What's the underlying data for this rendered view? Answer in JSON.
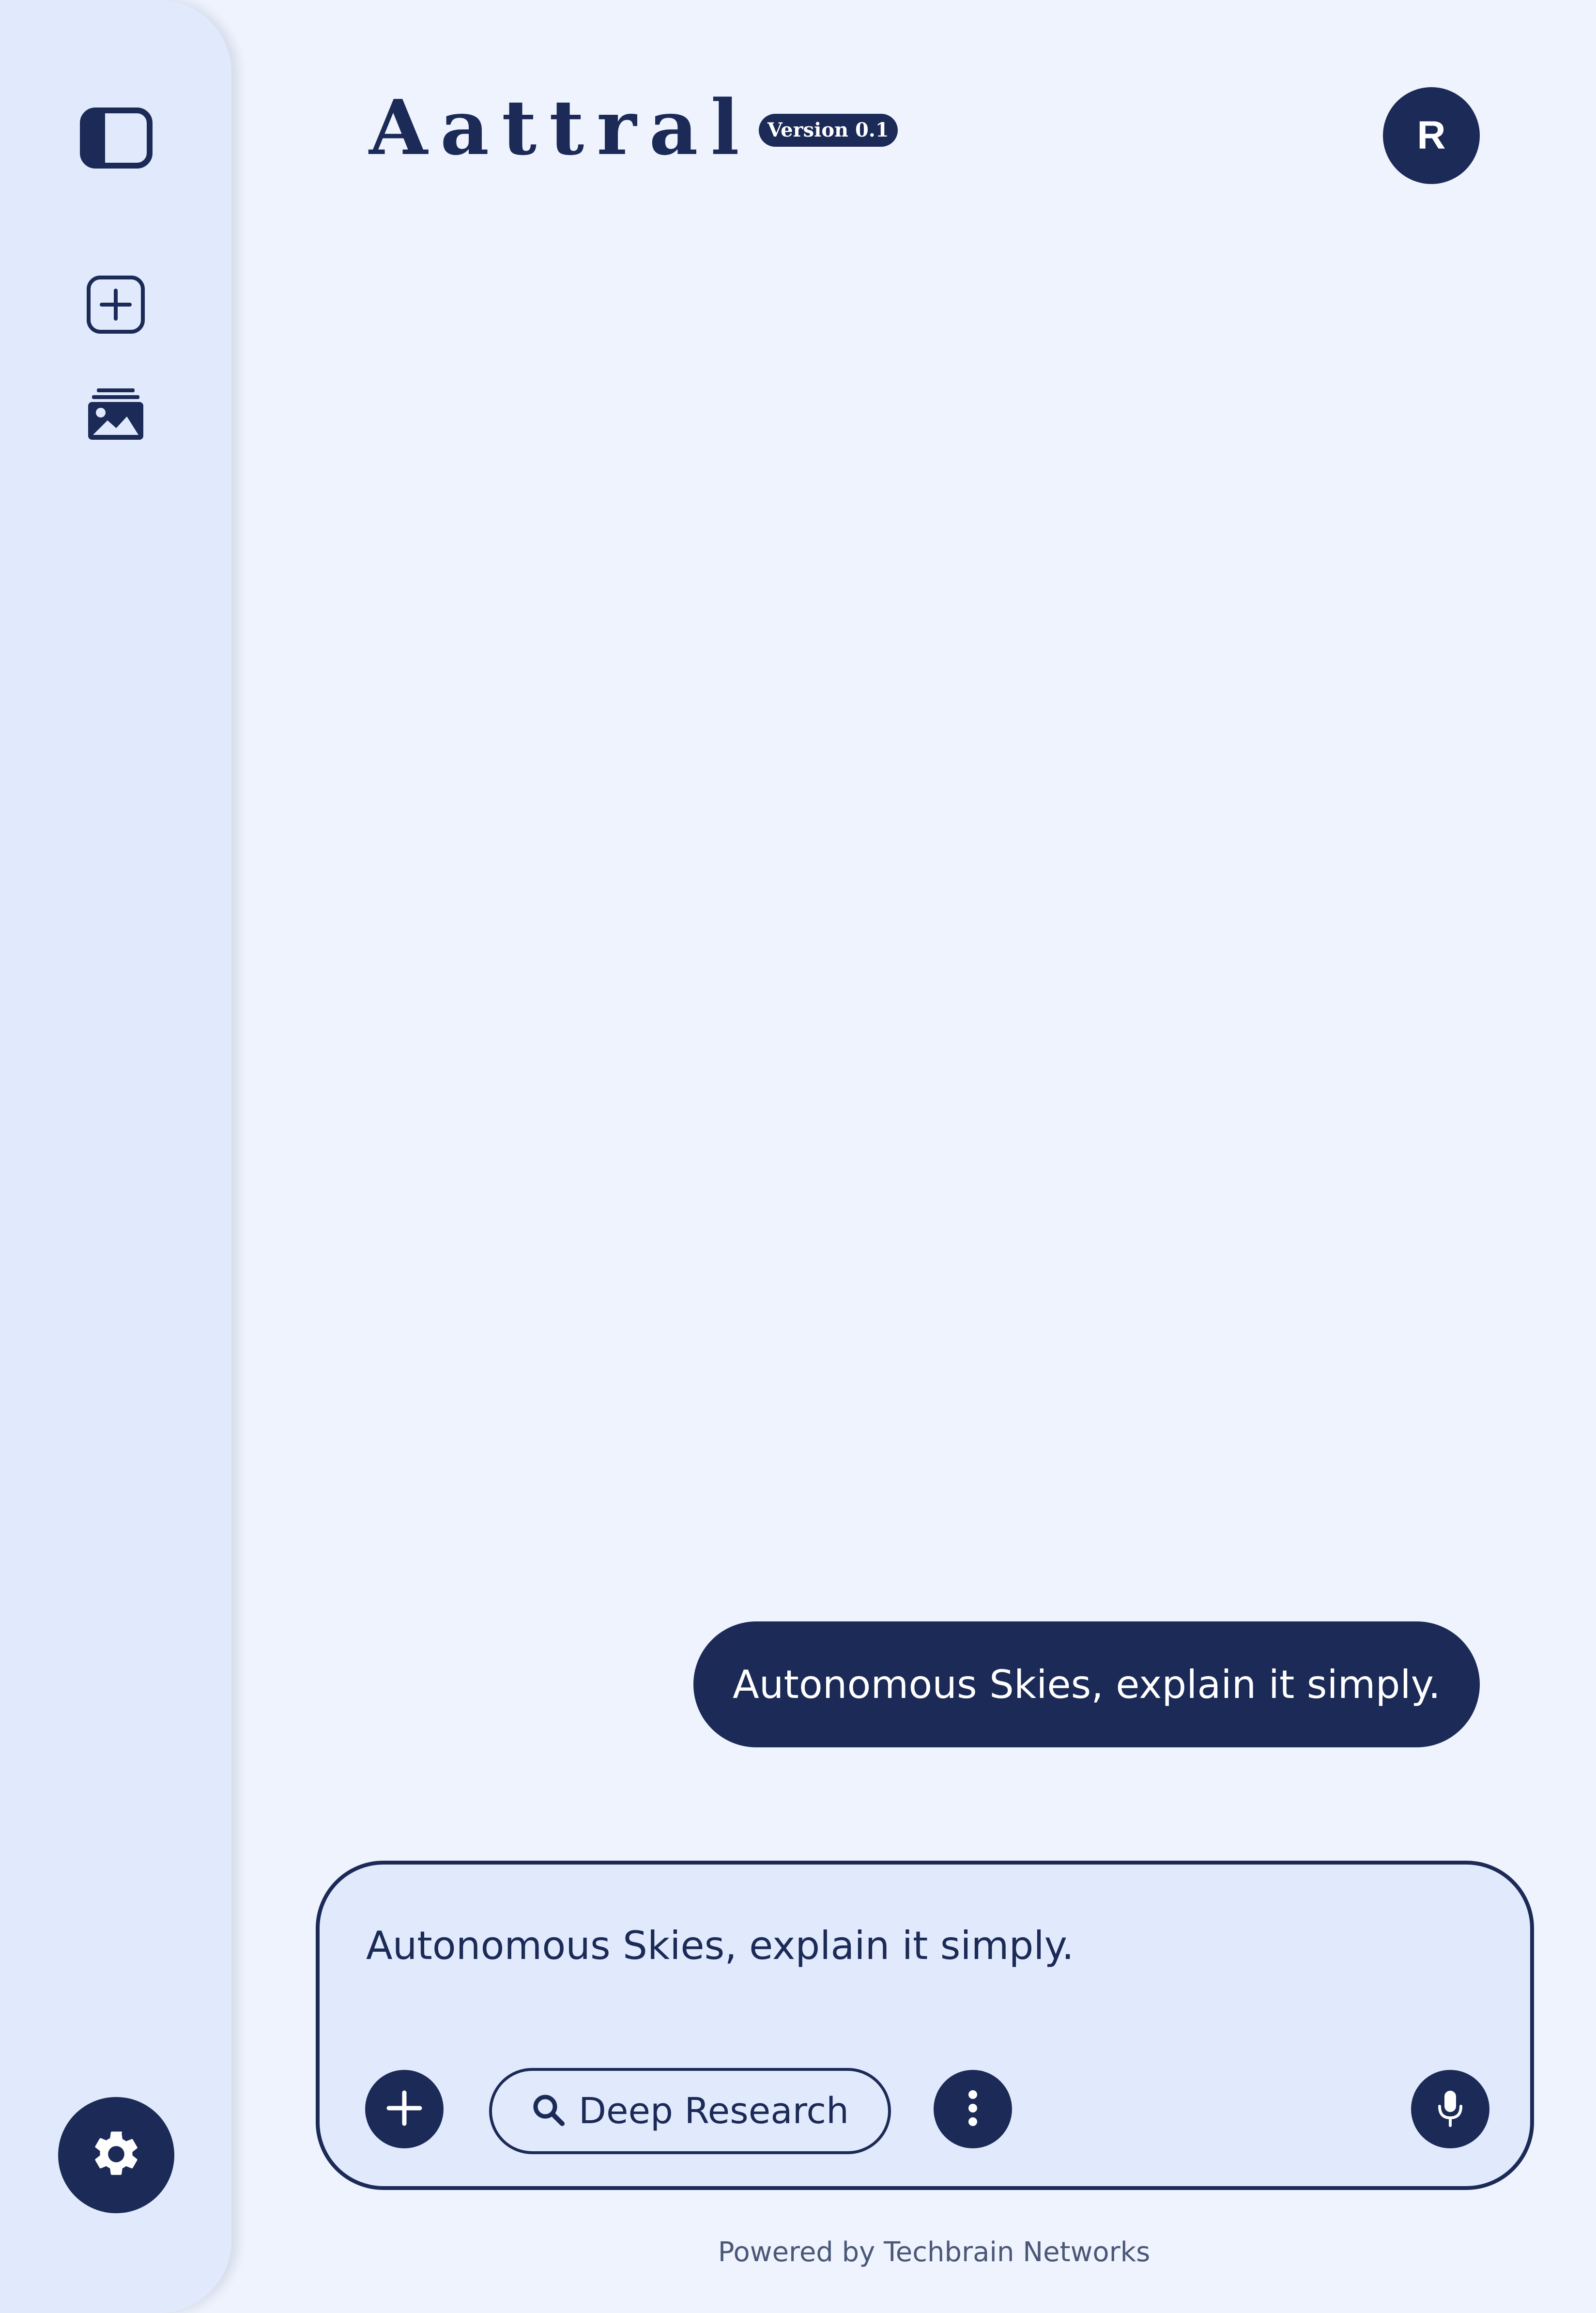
{
  "app": {
    "title": "Aattral",
    "version": "Version 0.1"
  },
  "sidebar": {
    "icons": [
      "sidebar-toggle-icon",
      "new-chat-icon",
      "gallery-icon",
      "gear-icon"
    ]
  },
  "header": {
    "avatar_initial": "R"
  },
  "chat": {
    "messages": [
      {
        "role": "user",
        "text": "Autonomous Skies, explain it simply."
      }
    ]
  },
  "composer": {
    "value": "Autonomous Skies, explain it simply.",
    "deep_research_label": "Deep Research",
    "icons": [
      "plus-icon",
      "search-icon",
      "more-vertical-icon",
      "microphone-icon"
    ]
  },
  "footer": {
    "text": "Powered by Techbrain Networks"
  },
  "colors": {
    "primary": "#1b2a56",
    "background": "#eef3fd",
    "sidebar": "#e1eafc",
    "muted_text": "#4a5777"
  }
}
